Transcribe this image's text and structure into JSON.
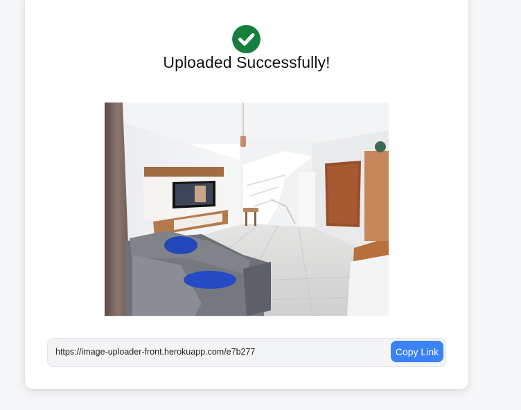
{
  "status": {
    "title": "Uploaded Successfully!",
    "icon": "check-circle-icon",
    "success_color": "#15803d"
  },
  "uploaded_image": {
    "description": "living-room-photo"
  },
  "share": {
    "link": "https://image-uploader-front.herokuapp.com/e7b277",
    "copy_label": "Copy Link",
    "button_color": "#3b82f6"
  }
}
